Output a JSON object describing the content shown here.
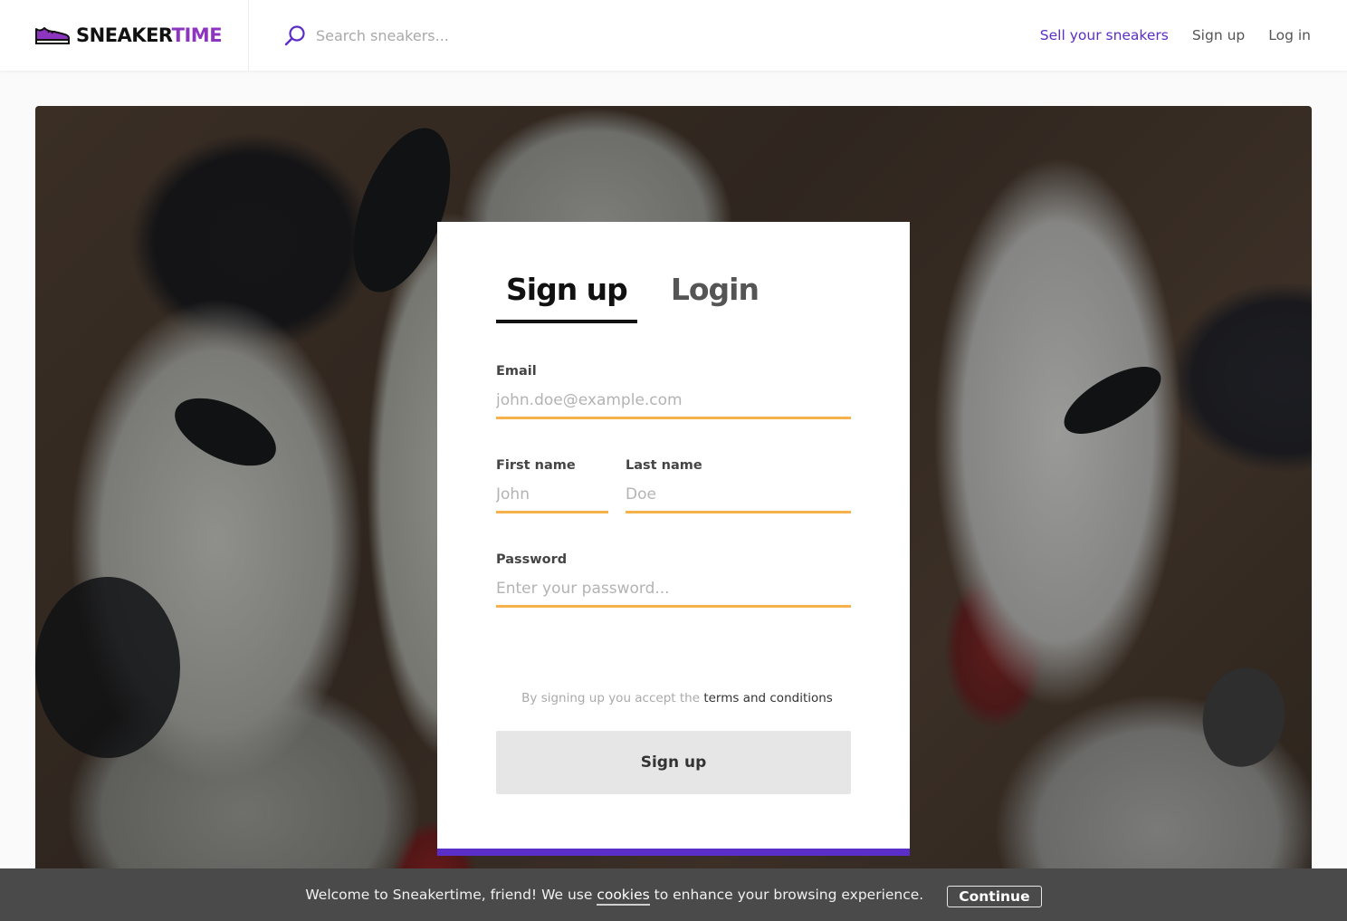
{
  "header": {
    "logo": {
      "part1": "SNEAKER",
      "part2": "TIME",
      "icon": "sneaker-icon"
    },
    "search": {
      "placeholder": "Search sneakers...",
      "value": "",
      "icon": "search-icon"
    },
    "nav": {
      "sell": "Sell your sneakers",
      "signup": "Sign up",
      "login": "Log in"
    }
  },
  "auth_card": {
    "tabs": [
      {
        "label": "Sign up",
        "active": true
      },
      {
        "label": "Login",
        "active": false
      }
    ],
    "fields": {
      "email": {
        "label": "Email",
        "placeholder": "john.doe@example.com",
        "value": ""
      },
      "first_name": {
        "label": "First name",
        "placeholder": "John",
        "value": ""
      },
      "last_name": {
        "label": "Last name",
        "placeholder": "Doe",
        "value": ""
      },
      "password": {
        "label": "Password",
        "placeholder": "Enter your password...",
        "value": ""
      }
    },
    "terms_prefix": "By signing up you accept the ",
    "terms_link": "terms and conditions",
    "submit_label": "Sign up"
  },
  "cookie_banner": {
    "text_before": "Welcome to Sneakertime, friend! We use ",
    "link": "cookies",
    "text_after": " to enhance your browsing experience.",
    "button": "Continue"
  },
  "colors": {
    "brand_purple": "#5b2ec7",
    "logo_purple": "#8e35c0",
    "input_underline": "#f5b24b",
    "cookie_bg": "#4a4a4a"
  }
}
